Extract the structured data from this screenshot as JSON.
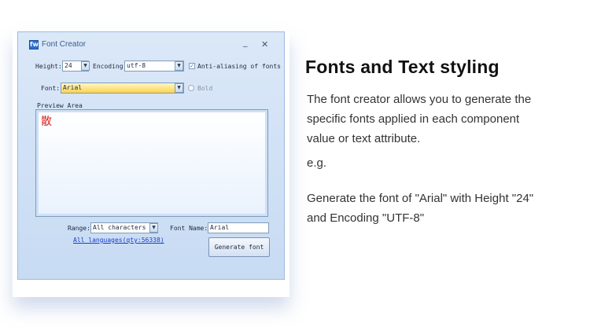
{
  "window": {
    "title": "Font Creator",
    "app_icon_text": "fw",
    "minimize_symbol": "_",
    "close_symbol": "✕"
  },
  "form": {
    "height_label": "Height:",
    "height_value": "24",
    "encoding_label": "Encoding:",
    "encoding_value": "utf-8",
    "antialias_label": "Anti-aliasing of fonts",
    "antialias_checked": true,
    "font_label": "Font:",
    "font_value": "Arial",
    "bold_label": "Bold",
    "bold_selected": false,
    "preview_label": "Preview Area",
    "preview_glyph": "散",
    "range_label": "Range:",
    "range_value": "All characters",
    "font_name_label": "Font Name:",
    "font_name_value": "Arial",
    "languages_link": "All languages(qty:56338)",
    "generate_button": "Generate font"
  },
  "description": {
    "heading": "Fonts and Text styling",
    "paragraph_lines": [
      "The font creator allows you to generate the",
      "specific fonts applied in each component",
      "value or text attribute."
    ],
    "example_label": "e.g.",
    "example_lines": [
      "Generate the font of \"Arial\" with Height \"24\"",
      "and Encoding \"UTF-8\""
    ]
  },
  "colors": {
    "window_bg": "#c7dbf3",
    "field_highlight": "#ffd24a",
    "preview_glyph": "#e02020",
    "link": "#1a3ecf"
  },
  "icons": {
    "dropdown": "chevron-down-icon",
    "checkbox": "check-icon",
    "radio": "radio-icon"
  }
}
